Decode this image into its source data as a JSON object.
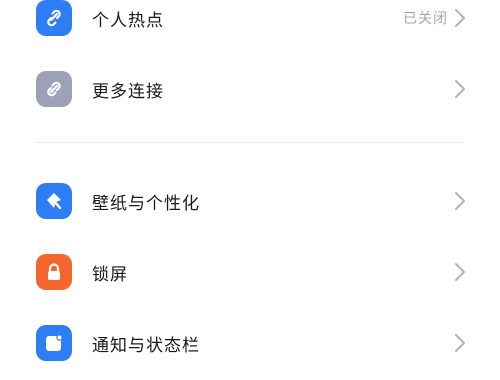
{
  "settings": {
    "group1": [
      {
        "label": "个人热点",
        "value": "已关闭",
        "icon": "hotspot-link-icon",
        "color": "#2f7df5"
      },
      {
        "label": "更多连接",
        "value": "",
        "icon": "connection-link-icon",
        "color": "#9ea0b8"
      }
    ],
    "group2": [
      {
        "label": "壁纸与个性化",
        "value": "",
        "icon": "brush-icon",
        "color": "#2f7df5"
      },
      {
        "label": "锁屏",
        "value": "",
        "icon": "lock-icon",
        "color": "#f5662f"
      },
      {
        "label": "通知与状态栏",
        "value": "",
        "icon": "notification-icon",
        "color": "#2f7df5"
      }
    ]
  }
}
